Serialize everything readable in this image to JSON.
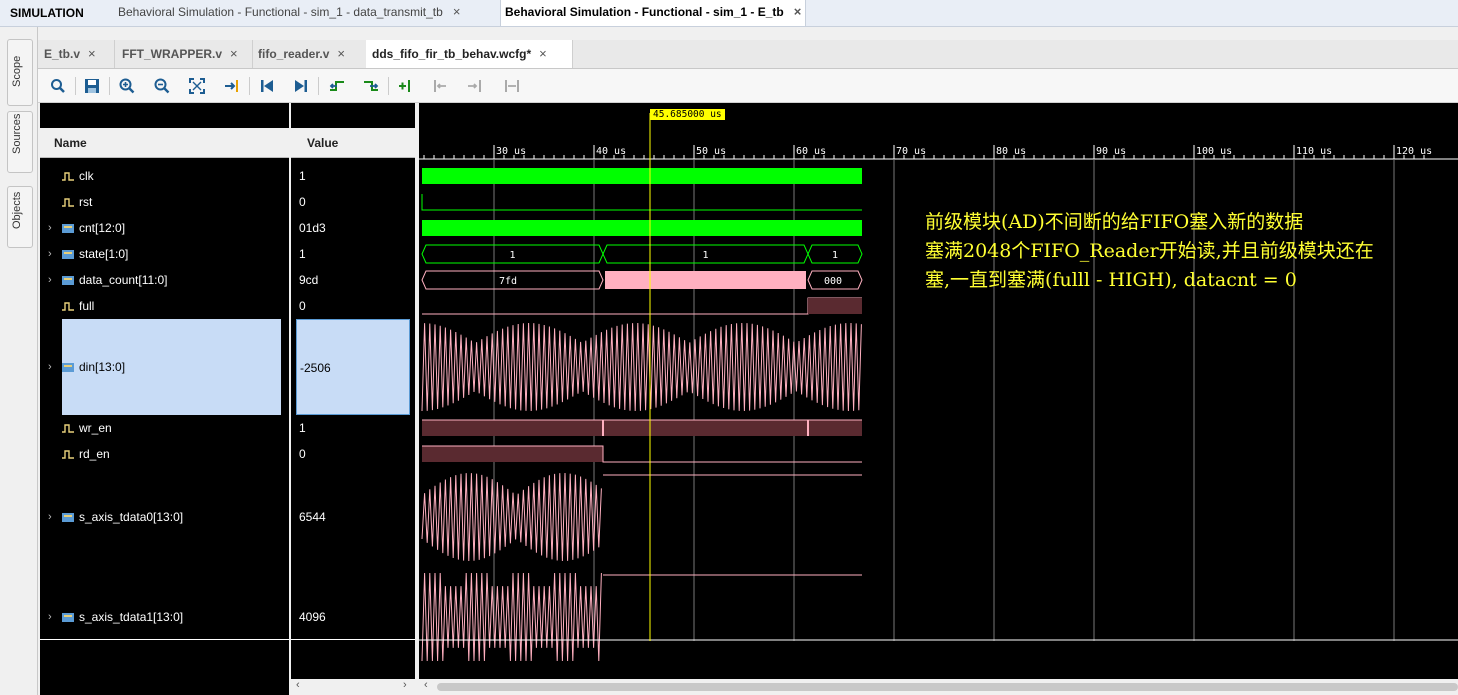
{
  "topbar": {
    "section": "SIMULATION",
    "tabs": [
      {
        "label": "Behavioral Simulation - Functional - sim_1 - data_transmit_tb",
        "close": "×"
      },
      {
        "label": "Behavioral Simulation - Functional - sim_1 - E_tb",
        "close": "×"
      }
    ]
  },
  "side_tabs": [
    "Scope",
    "Sources",
    "Objects"
  ],
  "editor_tabs": [
    {
      "label": "E_tb.v",
      "close": "×"
    },
    {
      "label": "FFT_WRAPPER.v",
      "close": "×"
    },
    {
      "label": "fifo_reader.v",
      "close": "×"
    },
    {
      "label": "dds_fifo_fir_tb_behav.wcfg*",
      "close": "×"
    }
  ],
  "toolbar": [
    "search-icon",
    "save-icon",
    "zoom-in-icon",
    "zoom-out-icon",
    "zoom-fit-icon",
    "go-to-cursor-icon",
    "go-to-start-icon",
    "go-to-end-icon",
    "previous-transition-icon",
    "next-transition-icon",
    "add-marker-icon",
    "previous-marker-icon",
    "next-marker-icon",
    "swap-cursors-icon"
  ],
  "columns": {
    "name": "Name",
    "value": "Value"
  },
  "signals": [
    {
      "name": "clk",
      "value": "1",
      "type": "bit",
      "expandable": false
    },
    {
      "name": "rst",
      "value": "0",
      "type": "bit",
      "expandable": false
    },
    {
      "name": "cnt[12:0]",
      "value": "01d3",
      "type": "bus",
      "expandable": true
    },
    {
      "name": "state[1:0]",
      "value": "1",
      "type": "bus",
      "expandable": true
    },
    {
      "name": "data_count[11:0]",
      "value": "9cd",
      "type": "bus",
      "expandable": true
    },
    {
      "name": "full",
      "value": "0",
      "type": "bit",
      "expandable": false
    },
    {
      "name": "din[13:0]",
      "value": "-2506",
      "type": "analog",
      "expandable": true,
      "selected": true
    },
    {
      "name": "wr_en",
      "value": "1",
      "type": "bit",
      "expandable": false
    },
    {
      "name": "rd_en",
      "value": "0",
      "type": "bit",
      "expandable": false
    },
    {
      "name": "s_axis_tdata0[13:0]",
      "value": "6544",
      "type": "bus",
      "expandable": true
    },
    {
      "name": "s_axis_tdata1[13:0]",
      "value": "4096",
      "type": "bus",
      "expandable": true
    }
  ],
  "cursor": {
    "label": "45.685000 us",
    "time_us": 45.685
  },
  "timeline": {
    "ticks": [
      "30 us",
      "40 us",
      "50 us",
      "60 us",
      "70 us",
      "80 us",
      "90 us",
      "100 us",
      "110 us",
      "120 us"
    ]
  },
  "bus_labels": {
    "state": [
      "1",
      "1",
      "1"
    ],
    "data_count": [
      "7fd",
      "000"
    ]
  },
  "annotation": {
    "line1": "前级模块(AD)不间断的给FIFO塞入新的数据",
    "line2": "塞满2048个FIFO_Reader开始读,并且前级模块还在",
    "line3": "塞,一直到塞满(fulll - HIGH), datacnt = 0"
  },
  "colors": {
    "wave_green": "#00ff00",
    "wave_pink": "#ffb0c0",
    "cursor": "#ffff00",
    "annotation": "#ffff33"
  }
}
